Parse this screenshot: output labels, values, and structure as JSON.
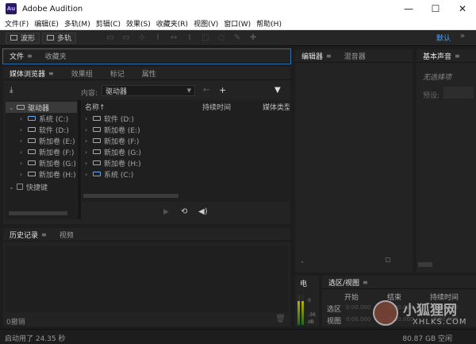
{
  "app": {
    "logo": "Au",
    "title": "Adobe Audition"
  },
  "window_controls": {
    "minimize": "—",
    "maximize": "☐",
    "close": "✕"
  },
  "menu": [
    "文件(F)",
    "编辑(E)",
    "多轨(M)",
    "剪辑(C)",
    "效果(S)",
    "收藏夹(R)",
    "视图(V)",
    "窗口(W)",
    "帮助(H)"
  ],
  "toolbar": {
    "waveform_label": "波形",
    "multitrack_label": "多轨",
    "workspace": "默认",
    "more": "»"
  },
  "files_panel": {
    "tabs": [
      "文件",
      "收藏夹"
    ]
  },
  "media_browser": {
    "tabs": [
      "媒体浏览器",
      "效果组",
      "标记",
      "属性"
    ],
    "content_label": "内容:",
    "content_value": "驱动器",
    "tree_root": "驱动器",
    "tree_items": [
      "系统 (C:)",
      "软件 (D:)",
      "新加卷 (E:)",
      "新加卷 (F:)",
      "新加卷 (G:)",
      "新加卷 (H:)"
    ],
    "shortcuts": "快捷键",
    "columns": [
      "名称",
      "持续时间",
      "媒体类型"
    ],
    "sort_indicator": "↑",
    "list_items": [
      "软件 (D:)",
      "新加卷 (E:)",
      "新加卷 (F:)",
      "新加卷 (G:)",
      "新加卷 (H:)",
      "系统 (C:)"
    ]
  },
  "history_panel": {
    "tabs": [
      "历史记录",
      "视频"
    ],
    "undo_count": "0撤销"
  },
  "editor_panel": {
    "tabs": [
      "编辑器",
      "混音器"
    ]
  },
  "essential_sound": {
    "tab": "基本声音",
    "no_selection": "无选择项",
    "preset_label": "预设:"
  },
  "levels": {
    "title": "电",
    "ticks": [
      "0",
      "-36",
      "dB"
    ]
  },
  "selection_view": {
    "tab": "选区/视图",
    "columns": [
      "开始",
      "结束",
      "持续时间"
    ],
    "rows": [
      {
        "label": "选区",
        "start": "0:00.000",
        "end": "0:00.000",
        "duration": "0:00.000"
      },
      {
        "label": "视图",
        "start": "0:00.000",
        "end": "0:00.000",
        "duration": "0:00.000"
      }
    ]
  },
  "status": {
    "left": "启动用了 24.35 秒",
    "right": "80.87 GB 空闲"
  },
  "watermark": {
    "text": "小狐狸网",
    "url": "XHLKS.COM"
  }
}
